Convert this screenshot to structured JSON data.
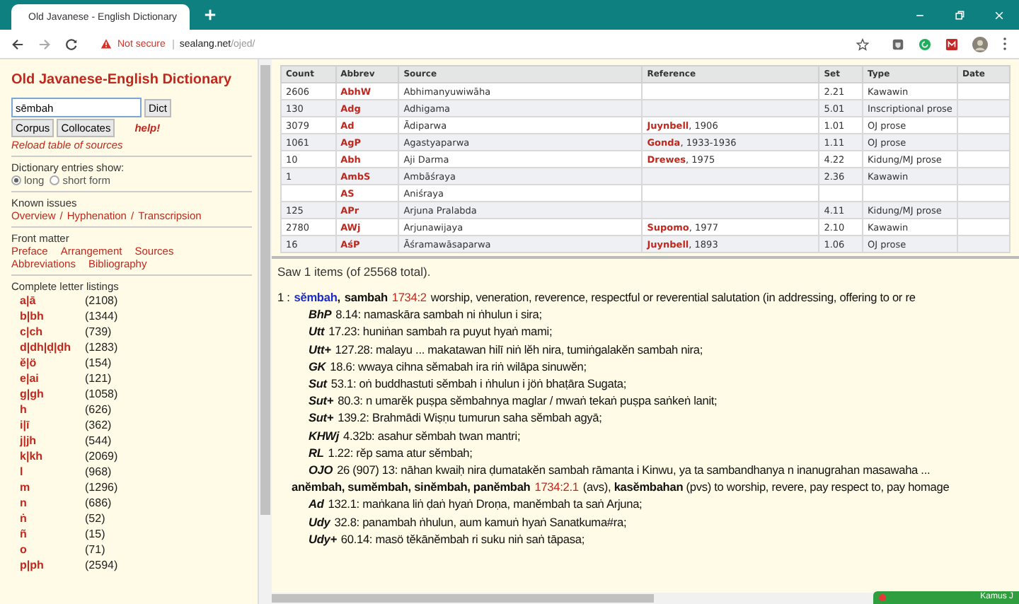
{
  "browser": {
    "tabs": [
      {
        "title": "Old Javanese - English Dictionary",
        "selected": true
      }
    ],
    "security": "Not secure",
    "url_host": "sealang.net",
    "url_path": "/ojed/"
  },
  "sidebar": {
    "title": "Old Javanese-English Dictionary",
    "search_value": "sēmbah",
    "dict_button": "Dict",
    "buttons": [
      "Corpus",
      "Collocates"
    ],
    "help_link": "help!",
    "reload_link": "Reload table of sources",
    "entries_heading": "Dictionary entries show:",
    "radios": [
      {
        "label": "long",
        "selected": true
      },
      {
        "label": "short form",
        "selected": false
      }
    ],
    "issues_heading": "Known issues",
    "issues_links": [
      "Overview",
      "Hyphenation",
      "Transcripsion"
    ],
    "separator": "/",
    "front_heading": "Front matter",
    "front_links": [
      [
        "Preface",
        "Arrangement",
        "Sources"
      ],
      [
        "Abbreviations",
        "Bibliography"
      ]
    ],
    "listing_heading": "Complete letter listings",
    "letters": [
      {
        "letter": "a|ā",
        "count": "(2108)"
      },
      {
        "letter": "b|bh",
        "count": "(1344)"
      },
      {
        "letter": "c|ch",
        "count": "(739)"
      },
      {
        "letter": "d|dh|ḍ|ḍh",
        "count": "(1283)"
      },
      {
        "letter": "ĕ|ö",
        "count": "(154)"
      },
      {
        "letter": "e|ai",
        "count": "(121)"
      },
      {
        "letter": "g|gh",
        "count": "(1058)"
      },
      {
        "letter": "h",
        "count": "(626)"
      },
      {
        "letter": "i|ī",
        "count": "(362)"
      },
      {
        "letter": "j|jh",
        "count": "(544)"
      },
      {
        "letter": "k|kh",
        "count": "(2069)"
      },
      {
        "letter": "l",
        "count": "(968)"
      },
      {
        "letter": "m",
        "count": "(1296)"
      },
      {
        "letter": "n",
        "count": "(686)"
      },
      {
        "letter": "ṅ",
        "count": "(52)"
      },
      {
        "letter": "ñ",
        "count": "(15)"
      },
      {
        "letter": "o",
        "count": "(71)"
      },
      {
        "letter": "p|ph",
        "count": "(2594)"
      }
    ]
  },
  "table": {
    "columns": [
      "Count",
      "Abbrev",
      "Source",
      "Reference",
      "Set",
      "Type",
      "Date"
    ],
    "rows": [
      {
        "count": "2606",
        "abbrev": "AbhW",
        "source": "Abhimanyuwiwāha",
        "ref_author": "",
        "ref_year": "",
        "set": "2.21",
        "type": "Kawawin"
      },
      {
        "count": "130",
        "abbrev": "Adg",
        "source": "Adhigama",
        "ref_author": "",
        "ref_year": "",
        "set": "5.01",
        "type": "Inscriptional prose"
      },
      {
        "count": "3079",
        "abbrev": "Ad",
        "source": "Ādiparwa",
        "ref_author": "Juynbell",
        "ref_year": ", 1906",
        "set": "1.01",
        "type": "OJ prose"
      },
      {
        "count": "1061",
        "abbrev": "AgP",
        "source": "Agastyaparwa",
        "ref_author": "Gonda",
        "ref_year": ", 1933-1936",
        "set": "1.11",
        "type": "OJ prose"
      },
      {
        "count": "10",
        "abbrev": "Abh",
        "source": "Aji Darma",
        "ref_author": "Drewes",
        "ref_year": ", 1975",
        "set": "4.22",
        "type": "Kidung/MJ prose"
      },
      {
        "count": "1",
        "abbrev": "AmbS",
        "source": "Ambāśraya",
        "ref_author": "",
        "ref_year": "",
        "set": "2.36",
        "type": "Kawawin"
      },
      {
        "count": "",
        "abbrev": "AS",
        "source": "Aniśraya",
        "ref_author": "",
        "ref_year": "",
        "set": "",
        "type": ""
      },
      {
        "count": "125",
        "abbrev": "APr",
        "source": "Arjuna Pralabda",
        "ref_author": "",
        "ref_year": "",
        "set": "4.11",
        "type": "Kidung/MJ prose"
      },
      {
        "count": "2780",
        "abbrev": "AWj",
        "source": "Arjunawijaya",
        "ref_author": "Supomo",
        "ref_year": ", 1977",
        "set": "2.10",
        "type": "Kawawin"
      },
      {
        "count": "16",
        "abbrev": "AśP",
        "source": "Āśramawāsaparwa",
        "ref_author": "Juynbell",
        "ref_year": ", 1893",
        "set": "1.06",
        "type": "OJ prose"
      }
    ]
  },
  "results": {
    "summary": "Saw 1 items (of 25568 total).",
    "entry": {
      "index": "1 :",
      "headword_separator": ",",
      "headwords": [
        {
          "text": "sĕmbah",
          "kind": "main"
        },
        {
          "text": "sambah",
          "kind": "variant"
        }
      ],
      "number": "1734:2",
      "gloss": "worship, veneration, reverence, respectful or reverential salutation (in addressing, offering to or re",
      "citations": [
        {
          "source": "BhP",
          "text": "8.14: namaskāra sambah ni ṅhulun i sira;"
        },
        {
          "source": "Utt",
          "text": "17.23: huniṅan sambah ra puyut hyaṅ mami;"
        },
        {
          "source": "Utt+",
          "text": "127.28: malayu ... makatawan hilī niṅ lĕh nira, tumiṅgalakĕn sambah nira;"
        },
        {
          "source": "GK",
          "text": "18.6: wwaya cihna sĕmabah ira riṅ wilāpa sinuwĕn;"
        },
        {
          "source": "Sut",
          "text": "53.1: oṅ buddhastuti sĕmbah i ṅhulun i jöṅ bhaṭāra Sugata;"
        },
        {
          "source": "Sut+",
          "text": "80.3: n umarĕk puṣpa sĕmbahnya maglar / mwaṅ tekaṅ puṣpa saṅkeṅ lanit;"
        },
        {
          "source": "Sut+",
          "text": "139.2: Brahmādi Wiṣṇu tumurun saha sĕmbah agyā;"
        },
        {
          "source": "KHWj",
          "text": "4.32b: asahur sĕmbah twan mantri;"
        },
        {
          "source": "RL",
          "text": "1.22: rĕp sama atur sĕmbah;"
        },
        {
          "source": "OJO",
          "text": "26 (907) 13: nāhan kwaiḥ nira ḍumatakĕn sambah rāmanta i Kinwu, ya ta sambandhanya n inanugrahan masawaha ..."
        }
      ]
    },
    "sense": {
      "headwords": "anĕmbah, sumĕmbah, sinĕmbah, panĕmbah",
      "number": "1734:2.1",
      "gloss": "(avs), **kasĕmbahan** (pvs) to worship, revere, pay respect to, pay homage",
      "citations": [
        {
          "source": "Ad",
          "text": "132.1: maṅkana liṅ ḍaṅ hyaṅ Droṇa, manĕmbah ta saṅ Arjuna;"
        },
        {
          "source": "Udy",
          "text": "32.8: panambah ṅhulun, aum kamuṅ hyaṅ Sanatkuma#ra;"
        },
        {
          "source": "Udy+",
          "text": "60.14: masö tĕkānĕmbah ri suku niṅ saṅ tāpasa;"
        }
      ]
    }
  },
  "notification": {
    "text": "Kamus J"
  }
}
